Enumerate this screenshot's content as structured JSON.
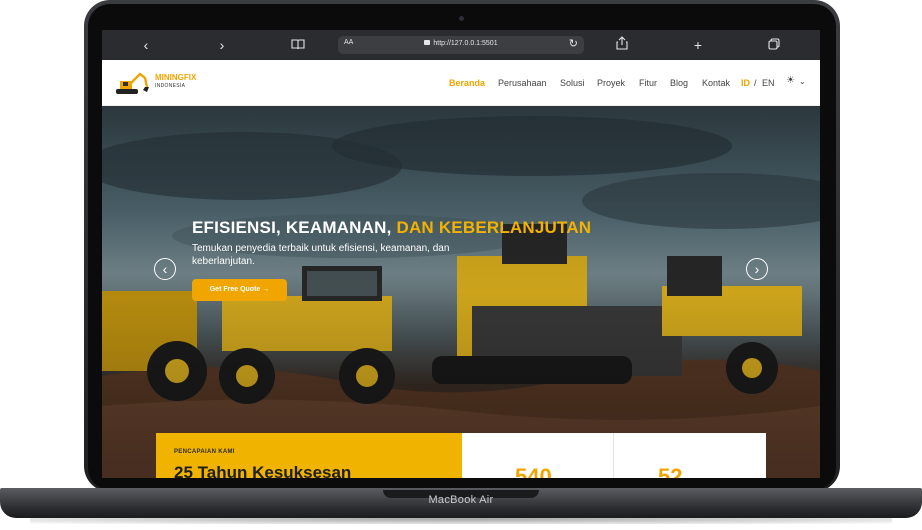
{
  "device": {
    "label": "MacBook Air"
  },
  "browser": {
    "reader_label": "AA",
    "url": "http://127.0.0.1:5501"
  },
  "site": {
    "logo_name": "MININGFIX",
    "logo_sub": "INDONESIA",
    "nav": [
      "Beranda",
      "Perusahaan",
      "Solusi",
      "Proyek",
      "Fitur",
      "Blog",
      "Kontak"
    ],
    "active_nav": "Beranda",
    "lang": {
      "id": "ID",
      "separator": "/",
      "en": "EN",
      "active": "ID"
    },
    "theme_icon": "sun-icon"
  },
  "hero": {
    "title_main": "EFISIENSI, KEAMANAN,",
    "title_accent": "DAN KEBERLANJUTAN",
    "subtitle": "Temukan penyedia terbaik untuk efisiensi, keamanan, dan keberlanjutan.",
    "cta_label": "Get Free Quote →"
  },
  "stats": {
    "label": "PENCAPAIAN KAMI",
    "heading": "25 Tahun Kesuksesan",
    "numbers": [
      "540",
      "52"
    ]
  },
  "colors": {
    "accent": "#f0a500",
    "toolbar": "#2b2c2f"
  }
}
